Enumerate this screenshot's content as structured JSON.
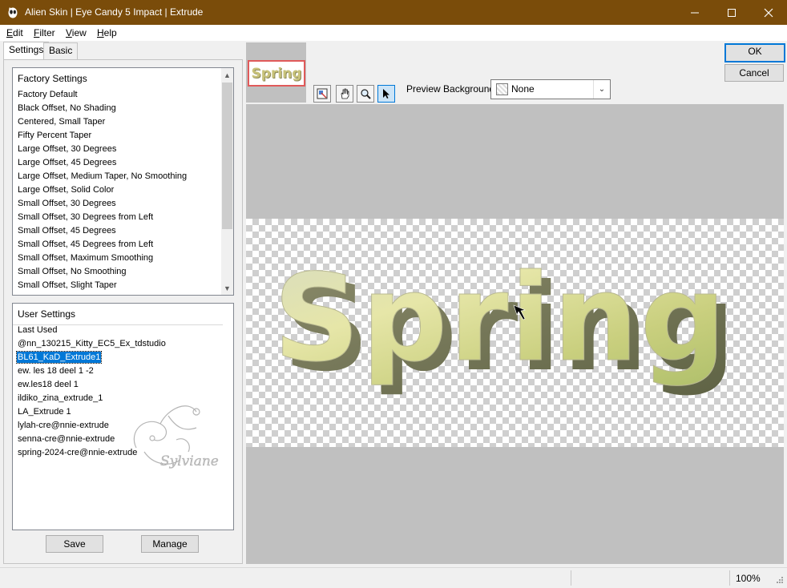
{
  "window": {
    "title": "Alien Skin | Eye Candy 5 Impact | Extrude",
    "minimize_glyph": "—",
    "maximize_glyph": "☐",
    "close_glyph": "✕"
  },
  "menu": {
    "edit": {
      "key": "E",
      "rest": "dit"
    },
    "filter": {
      "key": "F",
      "rest": "ilter"
    },
    "view": {
      "key": "V",
      "rest": "iew"
    },
    "help": {
      "key": "H",
      "rest": "elp"
    }
  },
  "tabs": {
    "settings": "Settings",
    "basic": "Basic"
  },
  "factory": {
    "header": "Factory Settings",
    "items": [
      "Factory Default",
      "Black Offset, No Shading",
      "Centered, Small Taper",
      "Fifty Percent Taper",
      "Large Offset, 30 Degrees",
      "Large Offset, 45 Degrees",
      "Large Offset, Medium Taper, No Smoothing",
      "Large Offset, Solid Color",
      "Small Offset, 30 Degrees",
      "Small Offset, 30 Degrees from Left",
      "Small Offset, 45 Degrees",
      "Small Offset, 45 Degrees from Left",
      "Small Offset, Maximum Smoothing",
      "Small Offset, No Smoothing",
      "Small Offset, Slight Taper"
    ]
  },
  "user": {
    "header": "User Settings",
    "items": [
      "Last Used",
      "@nn_130215_Kitty_EC5_Ex_tdstudio",
      "BL61_KaD_Extrude1",
      "ew. les 18 deel 1 -2",
      "ew.les18 deel 1",
      "ildiko_zina_extrude_1",
      "LA_Extrude 1",
      "lylah-cre@nnie-extrude",
      "senna-cre@nnie-extrude",
      "spring-2024-cre@nnie-extrude"
    ],
    "selected_index": 2
  },
  "buttons": {
    "save": "Save",
    "manage": "Manage",
    "ok": "OK",
    "cancel": "Cancel"
  },
  "preview_background": {
    "label": "Preview Background:",
    "value": "None"
  },
  "preview": {
    "text": "Spring"
  },
  "thumbnail": {
    "text": "Spring"
  },
  "watermark": {
    "text": "Sylviane"
  },
  "status": {
    "zoom": "100%"
  },
  "colors": {
    "titlebar": "#7a4c0a",
    "selection": "#0078d7",
    "preview_bg": "#c0c0c0"
  }
}
